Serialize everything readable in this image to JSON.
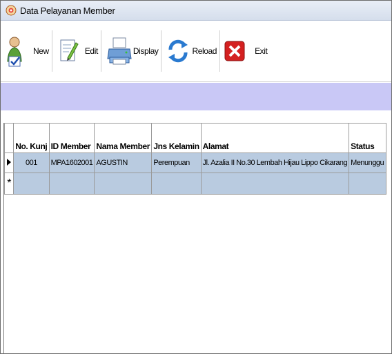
{
  "window": {
    "title": "Data Pelayanan Member"
  },
  "toolbar": {
    "buttons": [
      {
        "label": "New",
        "icon": "new-member-icon"
      },
      {
        "label": "Edit",
        "icon": "edit-icon"
      },
      {
        "label": "Display",
        "icon": "printer-icon"
      },
      {
        "label": "Reload",
        "icon": "reload-icon"
      },
      {
        "label": "Exit",
        "icon": "exit-icon"
      }
    ]
  },
  "grid": {
    "columns": [
      "No. Kunj",
      "ID Member",
      "Nama Member",
      "Jns Kelamin",
      "Alamat",
      "Status"
    ],
    "rows": [
      {
        "no_kunj": "001",
        "id_member": "MPA1602001",
        "nama_member": "AGUSTIN",
        "jns_kelamin": "Perempuan",
        "alamat": "Jl. Azalia II No.30 Lembah Hijau Lippo Cikarang",
        "status": "Menunggu"
      }
    ],
    "new_row_marker": "*"
  },
  "colors": {
    "band": "#c9c8f6",
    "row_selected": "#b9cbe0",
    "exit_red": "#d42020"
  }
}
